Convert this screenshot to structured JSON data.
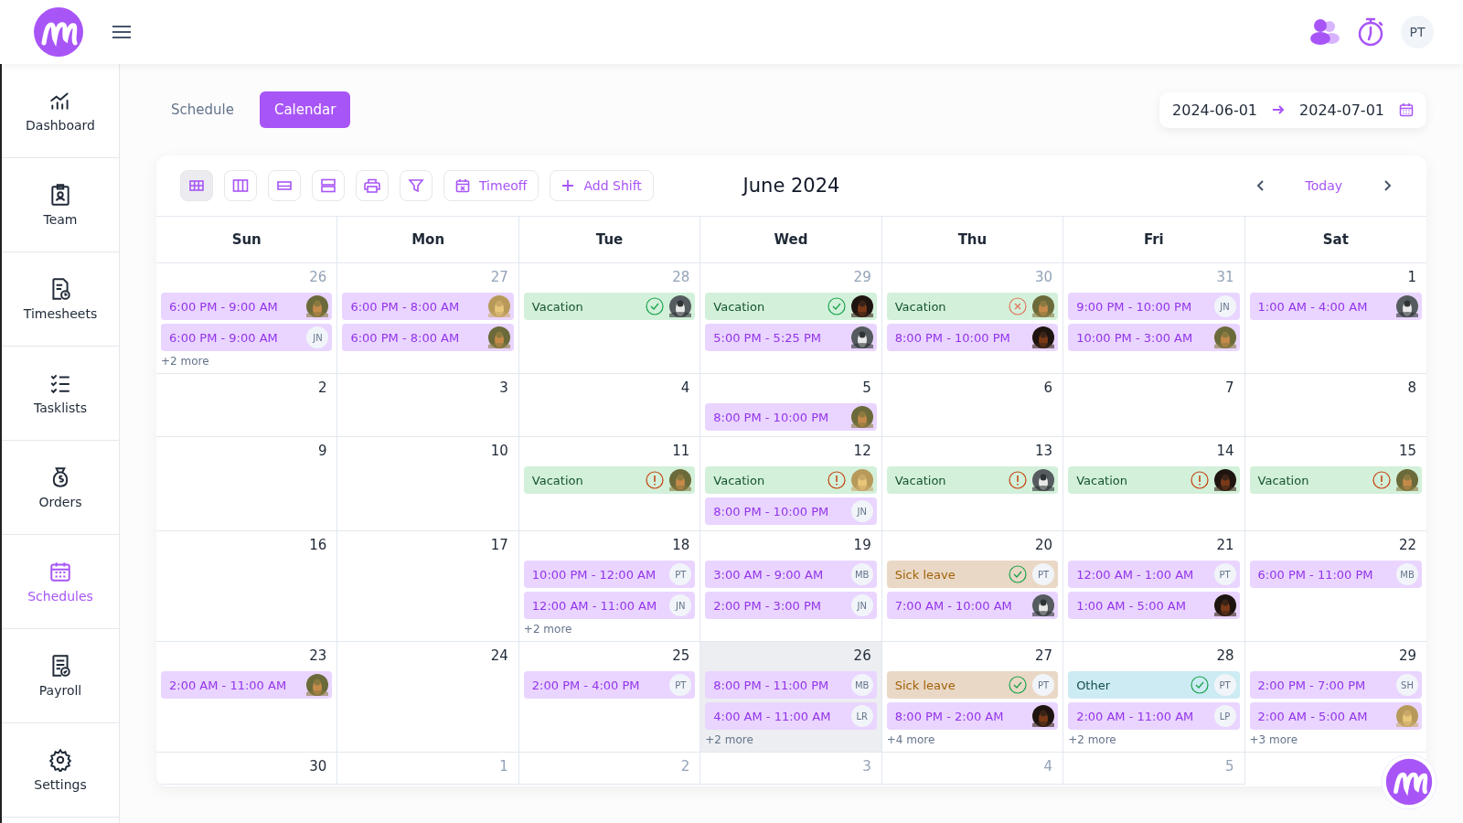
{
  "topbar": {
    "user_initials": "PT"
  },
  "sidebar": {
    "items": [
      {
        "label": "Dashboard",
        "selected": false
      },
      {
        "label": "Team",
        "selected": false
      },
      {
        "label": "Timesheets",
        "selected": false
      },
      {
        "label": "Tasklists",
        "selected": false
      },
      {
        "label": "Orders",
        "selected": false
      },
      {
        "label": "Schedules",
        "selected": true
      },
      {
        "label": "Payroll",
        "selected": false
      },
      {
        "label": "Settings",
        "selected": false
      }
    ]
  },
  "tabs": [
    {
      "label": "Schedule",
      "selected": false
    },
    {
      "label": "Calendar",
      "selected": true
    }
  ],
  "date_range": {
    "start": "2024-06-01",
    "end": "2024-07-01"
  },
  "calendar": {
    "title": "June 2024",
    "today_label": "Today",
    "view_buttons": [
      {
        "selected": true
      },
      {
        "selected": false
      },
      {
        "selected": false
      },
      {
        "selected": false
      },
      {
        "selected": false
      },
      {
        "selected": false
      }
    ],
    "timeoff_label": "Timeoff",
    "add_label": "Add Shift",
    "weekdays": [
      "Sun",
      "Mon",
      "Tue",
      "Wed",
      "Thu",
      "Fri",
      "Sat"
    ],
    "weeks": [
      [
        {
          "number": "26",
          "outside": true,
          "events": [
            {
              "kind": "shift",
              "label": "6:00 PM - 9:00 AM"
            },
            {
              "kind": "shift",
              "label": "6:00 PM - 9:00 AM",
              "avatar": {
                "initials": "JN"
              }
            }
          ],
          "more": "+2 more"
        },
        {
          "number": "27",
          "outside": true,
          "events": [
            {
              "kind": "shift",
              "label": "6:00 PM - 8:00 AM"
            },
            {
              "kind": "shift",
              "label": "6:00 PM - 8:00 AM"
            }
          ]
        },
        {
          "number": "28",
          "outside": true,
          "events": [
            {
              "kind": "vacation",
              "label": "Vacation",
              "status": {
                "kind": "approved"
              }
            }
          ]
        },
        {
          "number": "29",
          "outside": true,
          "events": [
            {
              "kind": "vacation",
              "label": "Vacation",
              "status": {
                "kind": "approved"
              }
            },
            {
              "kind": "shift",
              "label": "5:00 PM - 5:25 PM"
            }
          ]
        },
        {
          "number": "30",
          "outside": true,
          "events": [
            {
              "kind": "vacation",
              "label": "Vacation",
              "status": {
                "kind": "rejected"
              }
            },
            {
              "kind": "shift",
              "label": "8:00 PM - 10:00 PM"
            }
          ]
        },
        {
          "number": "31",
          "outside": true,
          "events": [
            {
              "kind": "shift",
              "label": "9:00 PM - 10:00 PM",
              "avatar": {
                "initials": "JN"
              }
            },
            {
              "kind": "shift",
              "label": "10:00 PM - 3:00 AM"
            }
          ]
        },
        {
          "number": "1",
          "outside": false,
          "events": [
            {
              "kind": "shift",
              "label": "1:00 AM - 4:00 AM"
            }
          ]
        }
      ],
      [
        {
          "number": "2",
          "outside": false
        },
        {
          "number": "3",
          "outside": false
        },
        {
          "number": "4",
          "outside": false
        },
        {
          "number": "5",
          "outside": false,
          "events": [
            {
              "kind": "shift",
              "label": "8:00 PM - 10:00 PM"
            }
          ]
        },
        {
          "number": "6",
          "outside": false
        },
        {
          "number": "7",
          "outside": false
        },
        {
          "number": "8",
          "outside": false
        }
      ],
      [
        {
          "number": "9",
          "outside": false
        },
        {
          "number": "10",
          "outside": false
        },
        {
          "number": "11",
          "outside": false,
          "events": [
            {
              "kind": "vacation",
              "label": "Vacation",
              "status": {
                "kind": "pending"
              }
            }
          ]
        },
        {
          "number": "12",
          "outside": false,
          "events": [
            {
              "kind": "vacation",
              "label": "Vacation",
              "status": {
                "kind": "pending"
              }
            },
            {
              "kind": "shift",
              "label": "8:00 PM - 10:00 PM",
              "avatar": {
                "initials": "JN"
              }
            }
          ]
        },
        {
          "number": "13",
          "outside": false,
          "events": [
            {
              "kind": "vacation",
              "label": "Vacation",
              "status": {
                "kind": "pending"
              }
            }
          ]
        },
        {
          "number": "14",
          "outside": false,
          "events": [
            {
              "kind": "vacation",
              "label": "Vacation",
              "status": {
                "kind": "pending"
              }
            }
          ]
        },
        {
          "number": "15",
          "outside": false,
          "events": [
            {
              "kind": "vacation",
              "label": "Vacation",
              "status": {
                "kind": "pending"
              }
            }
          ]
        }
      ],
      [
        {
          "number": "16",
          "outside": false
        },
        {
          "number": "17",
          "outside": false
        },
        {
          "number": "18",
          "outside": false,
          "events": [
            {
              "kind": "shift",
              "label": "10:00 PM - 12:00 AM",
              "avatar": {
                "initials": "PT"
              }
            },
            {
              "kind": "shift",
              "label": "12:00 AM - 11:00 AM",
              "avatar": {
                "initials": "JN"
              }
            }
          ],
          "more": "+2 more"
        },
        {
          "number": "19",
          "outside": false,
          "events": [
            {
              "kind": "shift",
              "label": "3:00 AM - 9:00 AM",
              "avatar": {
                "initials": "MB"
              }
            },
            {
              "kind": "shift",
              "label": "2:00 PM - 3:00 PM",
              "avatar": {
                "initials": "JN"
              }
            }
          ]
        },
        {
          "number": "20",
          "outside": false,
          "events": [
            {
              "kind": "sick",
              "label": "Sick leave",
              "status": {
                "kind": "approved"
              },
              "avatar": {
                "initials": "PT"
              }
            },
            {
              "kind": "shift",
              "label": "7:00 AM - 10:00 AM"
            }
          ]
        },
        {
          "number": "21",
          "outside": false,
          "events": [
            {
              "kind": "shift",
              "label": "12:00 AM - 1:00 AM",
              "avatar": {
                "initials": "PT"
              }
            },
            {
              "kind": "shift",
              "label": "1:00 AM - 5:00 AM"
            }
          ]
        },
        {
          "number": "22",
          "outside": false,
          "events": [
            {
              "kind": "shift",
              "label": "6:00 PM - 11:00 PM",
              "avatar": {
                "initials": "MB"
              }
            }
          ]
        }
      ],
      [
        {
          "number": "23",
          "outside": false,
          "events": [
            {
              "kind": "shift",
              "label": "2:00 AM - 11:00 AM"
            }
          ]
        },
        {
          "number": "24",
          "outside": false
        },
        {
          "number": "25",
          "outside": false,
          "events": [
            {
              "kind": "shift",
              "label": "2:00 PM - 4:00 PM",
              "avatar": {
                "initials": "PT"
              }
            }
          ]
        },
        {
          "number": "26",
          "outside": false,
          "highlighted": true,
          "events": [
            {
              "kind": "shift",
              "label": "8:00 PM - 11:00 PM",
              "avatar": {
                "initials": "MB"
              }
            },
            {
              "kind": "shift",
              "label": "4:00 AM - 11:00 AM",
              "avatar": {
                "initials": "LR"
              }
            }
          ],
          "more": "+2 more"
        },
        {
          "number": "27",
          "outside": false,
          "events": [
            {
              "kind": "sick",
              "label": "Sick leave",
              "status": {
                "kind": "approved"
              },
              "avatar": {
                "initials": "PT"
              }
            },
            {
              "kind": "shift",
              "label": "8:00 PM - 2:00 AM"
            }
          ],
          "more": "+4 more"
        },
        {
          "number": "28",
          "outside": false,
          "events": [
            {
              "kind": "other",
              "label": "Other",
              "status": {
                "kind": "approved"
              },
              "avatar": {
                "initials": "PT"
              }
            },
            {
              "kind": "shift",
              "label": "2:00 AM - 11:00 AM",
              "avatar": {
                "initials": "LP"
              }
            }
          ],
          "more": "+2 more"
        },
        {
          "number": "29",
          "outside": false,
          "events": [
            {
              "kind": "shift",
              "label": "2:00 PM - 7:00 PM",
              "avatar": {
                "initials": "SH"
              }
            },
            {
              "kind": "shift",
              "label": "2:00 AM - 5:00 AM"
            }
          ],
          "more": "+3 more"
        }
      ],
      [
        {
          "number": "30",
          "outside": false
        },
        {
          "number": "1",
          "outside": true
        },
        {
          "number": "2",
          "outside": true
        },
        {
          "number": "3",
          "outside": true
        },
        {
          "number": "4",
          "outside": true
        },
        {
          "number": "5",
          "outside": true
        }
      ]
    ]
  }
}
